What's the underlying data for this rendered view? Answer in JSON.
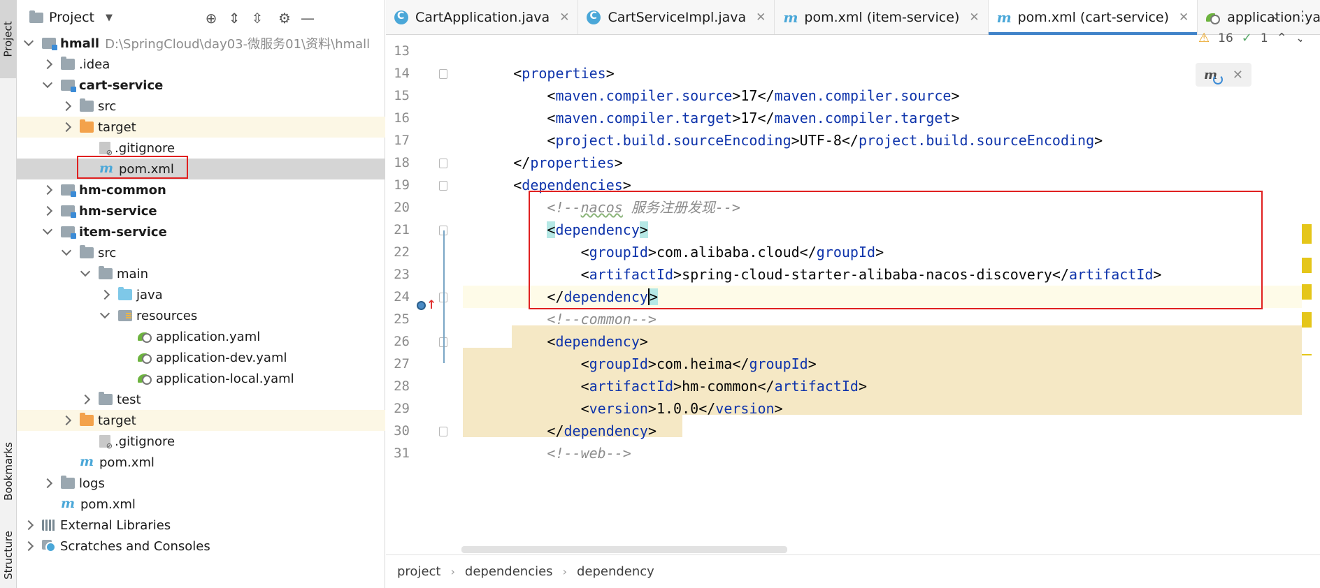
{
  "left_strip": {
    "project_tab": "Project",
    "bookmarks_tab": "Bookmarks",
    "structure_tab": "Structure"
  },
  "project_panel": {
    "title": "Project",
    "tree": [
      {
        "label": "hmall",
        "path": "D:\\SpringCloud\\day03-微服务01\\资料\\hmall"
      },
      {
        "label": ".idea"
      },
      {
        "label": "cart-service"
      },
      {
        "label": "src"
      },
      {
        "label": "target"
      },
      {
        "label": ".gitignore"
      },
      {
        "label": "pom.xml"
      },
      {
        "label": "hm-common"
      },
      {
        "label": "hm-service"
      },
      {
        "label": "item-service"
      },
      {
        "label": "src"
      },
      {
        "label": "main"
      },
      {
        "label": "java"
      },
      {
        "label": "resources"
      },
      {
        "label": "application.yaml"
      },
      {
        "label": "application-dev.yaml"
      },
      {
        "label": "application-local.yaml"
      },
      {
        "label": "test"
      },
      {
        "label": "target"
      },
      {
        "label": ".gitignore"
      },
      {
        "label": "pom.xml"
      },
      {
        "label": "logs"
      },
      {
        "label": "pom.xml"
      },
      {
        "label": "External Libraries"
      },
      {
        "label": "Scratches and Consoles"
      }
    ]
  },
  "tabs": [
    {
      "label": "CartApplication.java"
    },
    {
      "label": "CartServiceImpl.java"
    },
    {
      "label": "pom.xml (item-service)"
    },
    {
      "label": "pom.xml (cart-service)"
    },
    {
      "label": "application.yaml"
    }
  ],
  "inspection": {
    "warnings": "16",
    "ok": "1"
  },
  "code": {
    "line_numbers": [
      "13",
      "14",
      "15",
      "16",
      "17",
      "18",
      "19",
      "20",
      "21",
      "22",
      "23",
      "24",
      "25",
      "26",
      "27",
      "28",
      "29",
      "30",
      "31"
    ],
    "l14_tag": "properties",
    "l15_tag": "maven.compiler.source",
    "l15_val": "17",
    "l16_tag": "maven.compiler.target",
    "l16_val": "17",
    "l17_tag": "project.build.sourceEncoding",
    "l17_val": "UTF-8",
    "l18_tag": "properties",
    "l19_tag": "dependencies",
    "l20_comment_a": "<!--",
    "l20_comment_b": "nacos",
    "l20_comment_c": " 服务注册发现-->",
    "l21_tag": "dependency",
    "l22_tag": "groupId",
    "l22_val": "com.alibaba.cloud",
    "l23_tag": "artifactId",
    "l23_val": "spring-cloud-starter-alibaba-nacos-discovery",
    "l24_tag": "dependency",
    "l25_comment": "<!--common-->",
    "l26_tag": "dependency",
    "l27_tag": "groupId",
    "l27_val": "com.heima",
    "l28_tag": "artifactId",
    "l28_val": "hm-common",
    "l29_tag": "version",
    "l29_val": "1.0.0",
    "l30_tag": "dependency",
    "l31_comment": "<!--web-->"
  },
  "breadcrumb": [
    "project",
    "dependencies",
    "dependency"
  ],
  "colors": {
    "highlight_box": "#e02020",
    "selection": "#d5d5d5",
    "tag": "#0f34ab",
    "accent": "#4083c9"
  }
}
